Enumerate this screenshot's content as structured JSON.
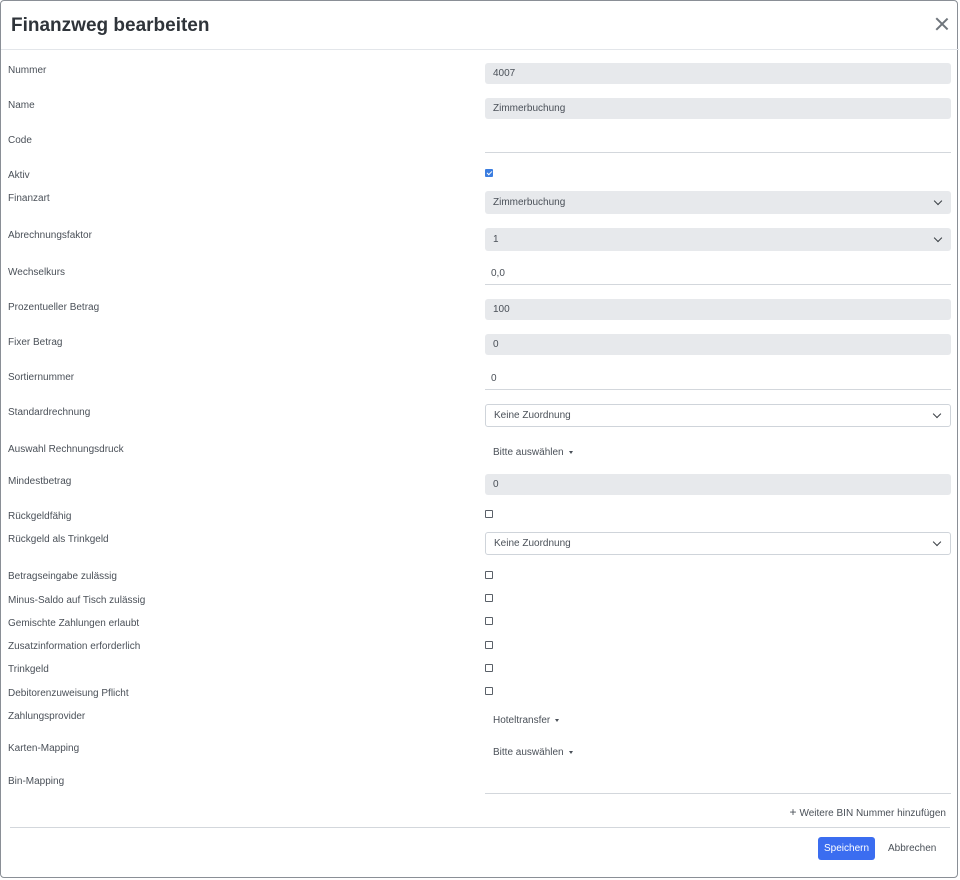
{
  "dialog": {
    "title": "Finanzweg bearbeiten"
  },
  "fields": {
    "nummer": {
      "label": "Nummer",
      "value": "4007"
    },
    "name": {
      "label": "Name",
      "value": "Zimmerbuchung"
    },
    "code": {
      "label": "Code",
      "value": ""
    },
    "aktiv": {
      "label": "Aktiv",
      "checked": true
    },
    "finanzart": {
      "label": "Finanzart",
      "value": "Zimmerbuchung"
    },
    "abrechnungsfaktor": {
      "label": "Abrechnungsfaktor",
      "value": "1"
    },
    "wechselkurs": {
      "label": "Wechselkurs",
      "value": "0,0"
    },
    "prozentueller_betrag": {
      "label": "Prozentueller Betrag",
      "value": "100"
    },
    "fixer_betrag": {
      "label": "Fixer Betrag",
      "value": "0"
    },
    "sortiernummer": {
      "label": "Sortiernummer",
      "value": "0"
    },
    "standardrechnung": {
      "label": "Standardrechnung",
      "value": "Keine Zuordnung"
    },
    "auswahl_rechnungsdruck": {
      "label": "Auswahl Rechnungsdruck",
      "value": "Bitte auswählen"
    },
    "mindestbetrag": {
      "label": "Mindestbetrag",
      "value": "0"
    },
    "rueckgeldfaehig": {
      "label": "Rückgeldfähig",
      "checked": false
    },
    "rueckgeld_trinkgeld": {
      "label": "Rückgeld als Trinkgeld",
      "value": "Keine Zuordnung"
    },
    "betragseingabe": {
      "label": "Betragseingabe zulässig",
      "checked": false
    },
    "minus_saldo": {
      "label": "Minus-Saldo auf Tisch zulässig",
      "checked": false
    },
    "gemischte_zahlungen": {
      "label": "Gemischte Zahlungen erlaubt",
      "checked": false
    },
    "zusatzinformation": {
      "label": "Zusatzinformation erforderlich",
      "checked": false
    },
    "trinkgeld": {
      "label": "Trinkgeld",
      "checked": false
    },
    "debitorenzuweisung": {
      "label": "Debitorenzuweisung Pflicht",
      "checked": false
    },
    "zahlungsprovider": {
      "label": "Zahlungsprovider",
      "value": "Hoteltransfer"
    },
    "karten_mapping": {
      "label": "Karten-Mapping",
      "value": "Bitte auswählen"
    },
    "bin_mapping": {
      "label": "Bin-Mapping",
      "add_label": "Weitere BIN Nummer hinzufügen"
    }
  },
  "footer": {
    "save_label": "Speichern",
    "cancel_label": "Abbrechen"
  },
  "colors": {
    "primary": "#3b6df0",
    "readonly_bg": "#e7e9ec",
    "checkbox_checked": "#3b7de0"
  }
}
